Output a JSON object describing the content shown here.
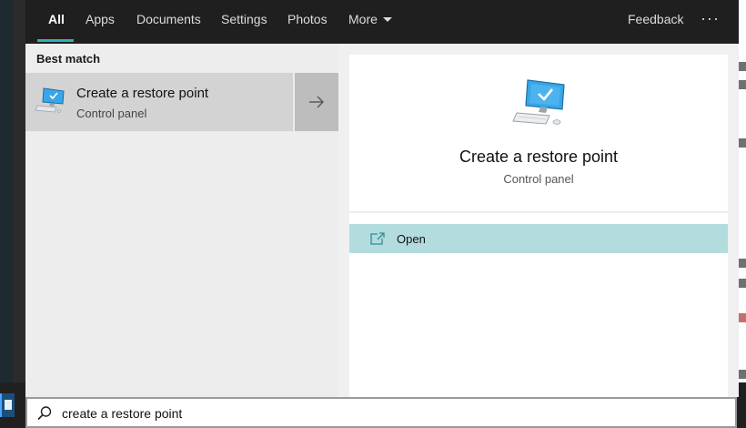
{
  "nav": {
    "tabs": [
      {
        "label": "All"
      },
      {
        "label": "Apps"
      },
      {
        "label": "Documents"
      },
      {
        "label": "Settings"
      },
      {
        "label": "Photos"
      },
      {
        "label": "More"
      }
    ],
    "active_tab": "All",
    "feedback_label": "Feedback",
    "more_options_label": "···"
  },
  "best_match": {
    "section_title": "Best match",
    "result": {
      "title": "Create a restore point",
      "subtitle": "Control panel",
      "icon": "monitor-check-icon"
    }
  },
  "detail": {
    "title": "Create a restore point",
    "subtitle": "Control panel",
    "icon": "monitor-check-icon",
    "actions": [
      {
        "label": "Open",
        "icon": "open-window-icon"
      }
    ]
  },
  "search": {
    "value": "create a restore point"
  },
  "colors": {
    "accent": "#2bb0b8",
    "nav_bg": "#1f1f1f",
    "open_action_bg": "#b3dcde",
    "monitor_blue": "#38a6e8"
  }
}
